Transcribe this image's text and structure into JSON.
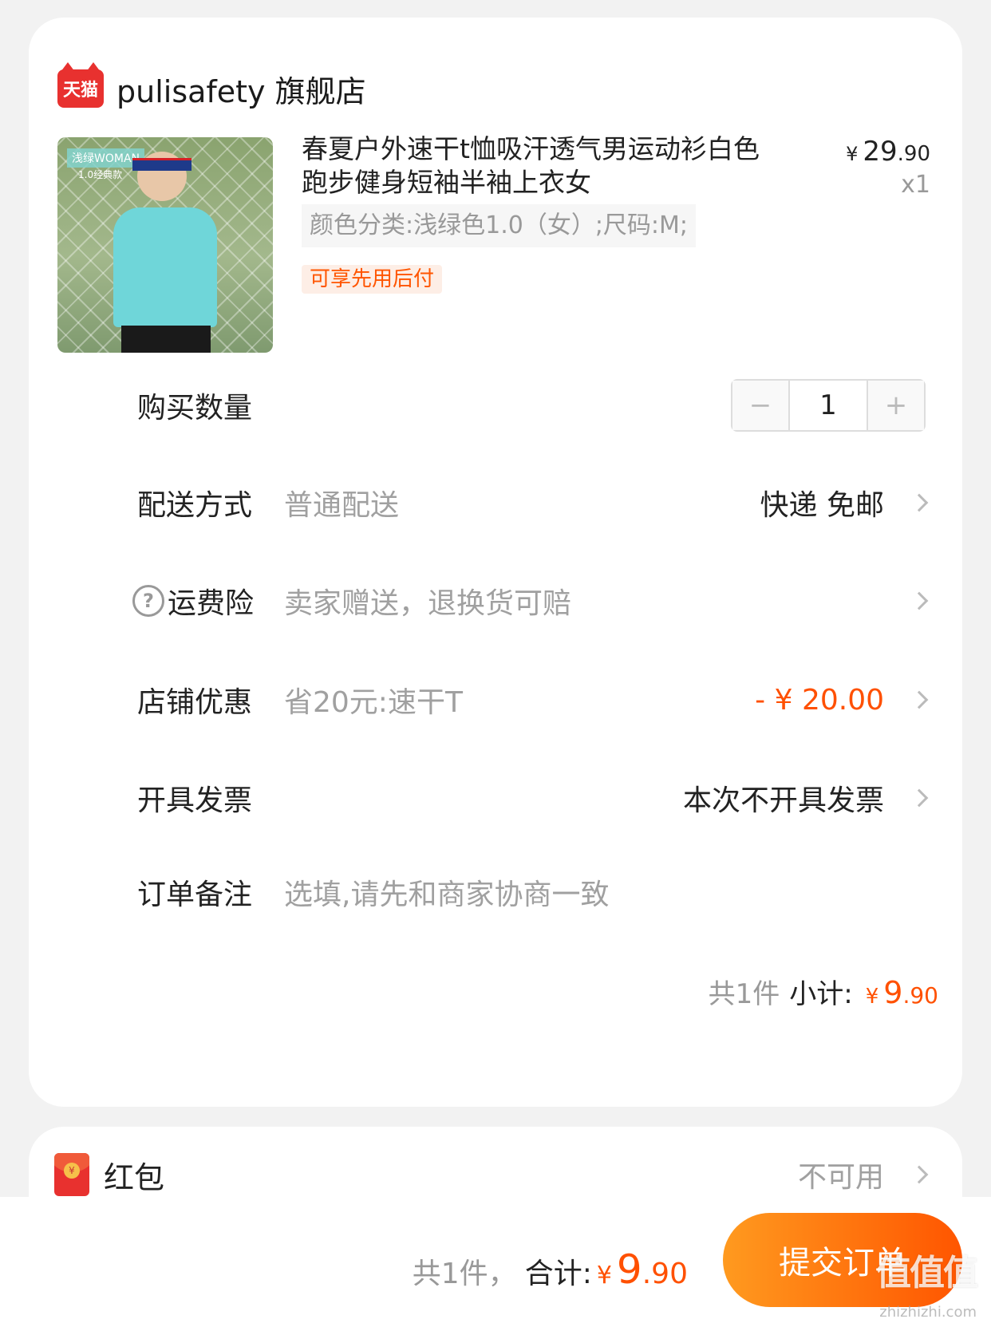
{
  "store": {
    "platform_logo_text": "天猫",
    "name": "pulisafety 旗舰店"
  },
  "product": {
    "image_badge": "浅绿WOMAN",
    "image_subbadge": "1.0经典款",
    "title": "春夏户外速干t恤吸汗透气男运动衫白色跑步健身短袖半袖上衣女",
    "price_currency": "¥",
    "price_int": "29",
    "price_dec": ".90",
    "qty_text": "x1",
    "sku": "颜色分类:浅绿色1.0（女）;尺码:M;",
    "tag": "可享先用后付"
  },
  "quantity": {
    "label": "购买数量",
    "minus": "−",
    "value": "1",
    "plus": "+"
  },
  "delivery": {
    "label": "配送方式",
    "desc": "普通配送",
    "value": "快递 免邮"
  },
  "insurance": {
    "label": "运费险",
    "help": "?",
    "desc": "卖家赠送，退换货可赔"
  },
  "discount": {
    "label": "店铺优惠",
    "desc": "省20元:速干T",
    "value": "- ¥ 20.00"
  },
  "invoice": {
    "label": "开具发票",
    "value": "本次不开具发票"
  },
  "note": {
    "label": "订单备注",
    "placeholder": "选填,请先和商家协商一致"
  },
  "subtotal": {
    "count": "共1件",
    "label": "小计:",
    "currency": "¥",
    "int": "9",
    "dec": ".90"
  },
  "red_packet": {
    "label": "红包",
    "coin": "¥",
    "value": "不可用"
  },
  "footer": {
    "count": "共1件，",
    "label": "合计:",
    "currency": "¥",
    "int": "9",
    "dec": ".90",
    "submit": "提交订单"
  },
  "watermark": {
    "text": "值值值",
    "url": "zhizhizhi.com"
  },
  "colors": {
    "accent": "#ff5000",
    "brand_red": "#e8312f"
  }
}
